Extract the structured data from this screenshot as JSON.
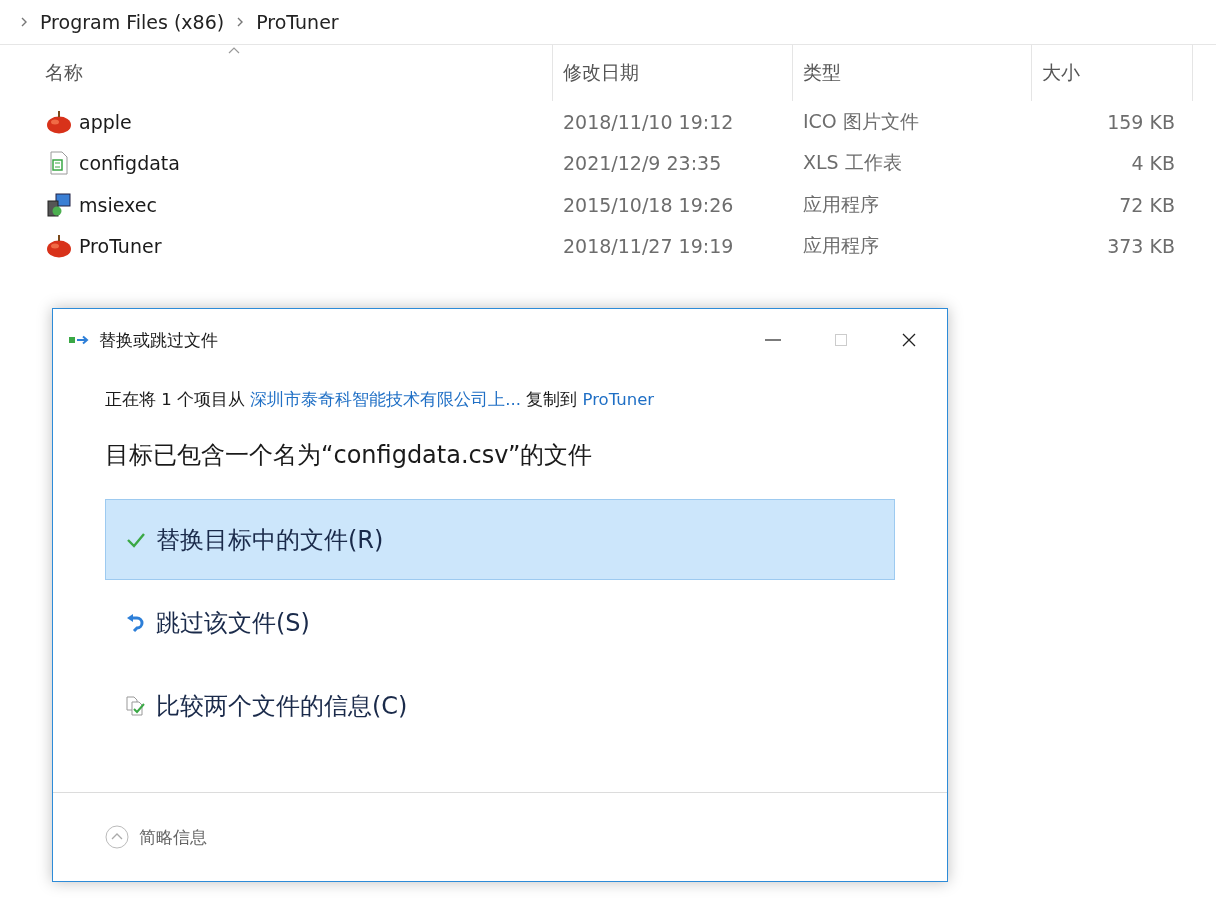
{
  "breadcrumb": [
    "Program Files (x86)",
    "ProTuner"
  ],
  "table": {
    "columns": [
      "名称",
      "修改日期",
      "类型",
      "大小"
    ],
    "rows": [
      {
        "kind": "apple",
        "name": "apple",
        "date": "2018/11/10 19:12",
        "type": "ICO 图片文件",
        "size": "159 KB"
      },
      {
        "kind": "sheet",
        "name": "configdata",
        "date": "2021/12/9 23:35",
        "type": "XLS 工作表",
        "size": "4 KB"
      },
      {
        "kind": "installer",
        "name": "msiexec",
        "date": "2015/10/18 19:26",
        "type": "应用程序",
        "size": "72 KB"
      },
      {
        "kind": "apple",
        "name": "ProTuner",
        "date": "2018/11/27 19:19",
        "type": "应用程序",
        "size": "373 KB"
      }
    ]
  },
  "dialog": {
    "title": "替换或跳过文件",
    "message": [
      {
        "kind": "text",
        "text": "正在将 1 个项目从 "
      },
      {
        "kind": "link",
        "text": "深圳市泰奇科智能技术有限公司上..."
      },
      {
        "kind": "text",
        "text": " 复制到 "
      },
      {
        "kind": "link",
        "text": "ProTuner"
      }
    ],
    "heading": "目标已包含一个名为“configdata.csv”的文件",
    "options": [
      {
        "kind": "replace",
        "label": "替换目标中的文件(R)",
        "selected": true
      },
      {
        "kind": "skip",
        "label": "跳过该文件(S)",
        "selected": false
      },
      {
        "kind": "compare",
        "label": "比较两个文件的信息(C)",
        "selected": false
      }
    ],
    "footer": "简略信息"
  }
}
